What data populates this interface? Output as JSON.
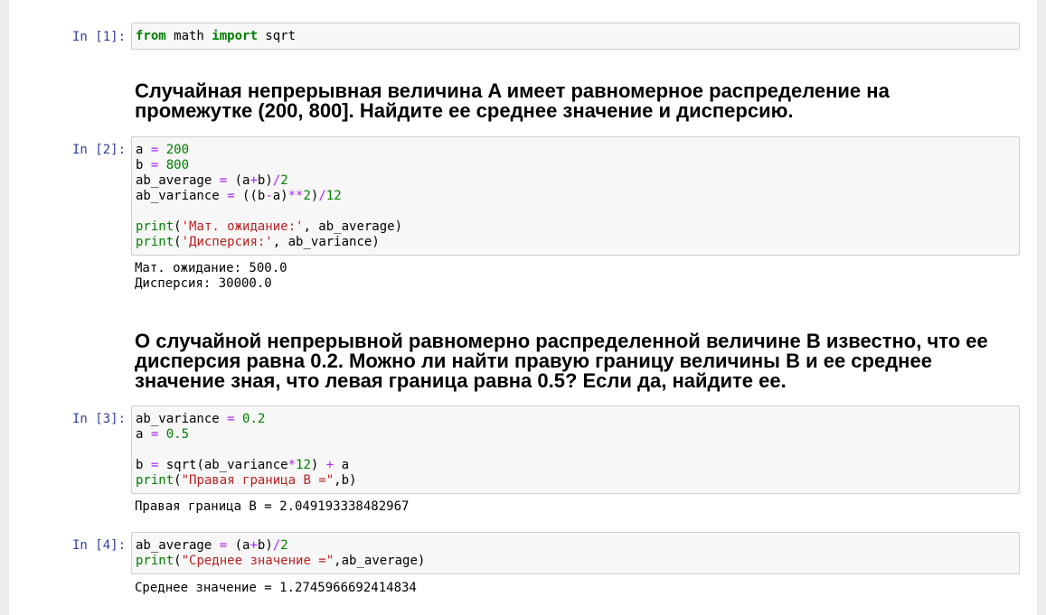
{
  "cells": {
    "c1": {
      "prompt": "In [1]:",
      "code": {
        "kw_from": "from",
        "mod": " math ",
        "kw_import": "import",
        "name": " sqrt"
      }
    },
    "md1": "Случайная непрерывная величина A имеет равномерное распределение на промежутке (200, 800]. Найдите ее среднее значение и дисперсию.",
    "c2": {
      "prompt": "In [2]:",
      "l1": {
        "v": "a",
        "eq": " = ",
        "n": "200"
      },
      "l2": {
        "v": "b",
        "eq": " = ",
        "n": "800"
      },
      "l3": {
        "v": "ab_average",
        "eq": " = ",
        "p1": "(a",
        "plus": "+",
        "p2": "b)",
        "div": "/",
        "n": "2"
      },
      "l4": {
        "v": "ab_variance",
        "eq": " = ",
        "p1": "((b",
        "minus": "-",
        "p2": "a)",
        "pow": "**",
        "n2": "2",
        "p3": ")",
        "div": "/",
        "n12": "12"
      },
      "l6": {
        "fn": "print",
        "o": "(",
        "s": "'Мат. ожидание:'",
        "rest": ", ab_average)"
      },
      "l7": {
        "fn": "print",
        "o": "(",
        "s": "'Дисперсия:'",
        "rest": ", ab_variance)"
      },
      "out1": "Мат. ожидание: 500.0",
      "out2": "Дисперсия: 30000.0"
    },
    "md2": "О случайной непрерывной равномерно распределенной величине B известно, что ее дисперсия равна 0.2. Можно ли найти правую границу величины B и ее среднее значение зная, что левая граница равна 0.5? Если да, найдите ее.",
    "c3": {
      "prompt": "In [3]:",
      "l1": {
        "v": "ab_variance",
        "eq": " = ",
        "n": "0.2"
      },
      "l2": {
        "v": "a",
        "eq": " = ",
        "n": "0.5"
      },
      "l4": {
        "v": "b",
        "eq": " = ",
        "fn": "sqrt(ab_variance",
        "mul": "*",
        "n": "12",
        "c": ") ",
        "plus": "+",
        "a": " a"
      },
      "l5": {
        "fn": "print",
        "o": "(",
        "s": "\"Правая граница B =\"",
        "rest": ",b)"
      },
      "out": "Правая граница B = 2.049193338482967"
    },
    "c4": {
      "prompt": "In [4]:",
      "l1": {
        "v": "ab_average",
        "eq": " = ",
        "p1": "(a",
        "plus": "+",
        "p2": "b)",
        "div": "/",
        "n": "2"
      },
      "l2": {
        "fn": "print",
        "o": "(",
        "s": "\"Среднее значение =\"",
        "rest": ",ab_average)"
      },
      "out": "Среднее значение = 1.2745966692414834"
    }
  },
  "colors": {
    "prompt": "#303f9f",
    "keyword": "#008000",
    "operator": "#aa22ff",
    "string": "#ba2121"
  }
}
